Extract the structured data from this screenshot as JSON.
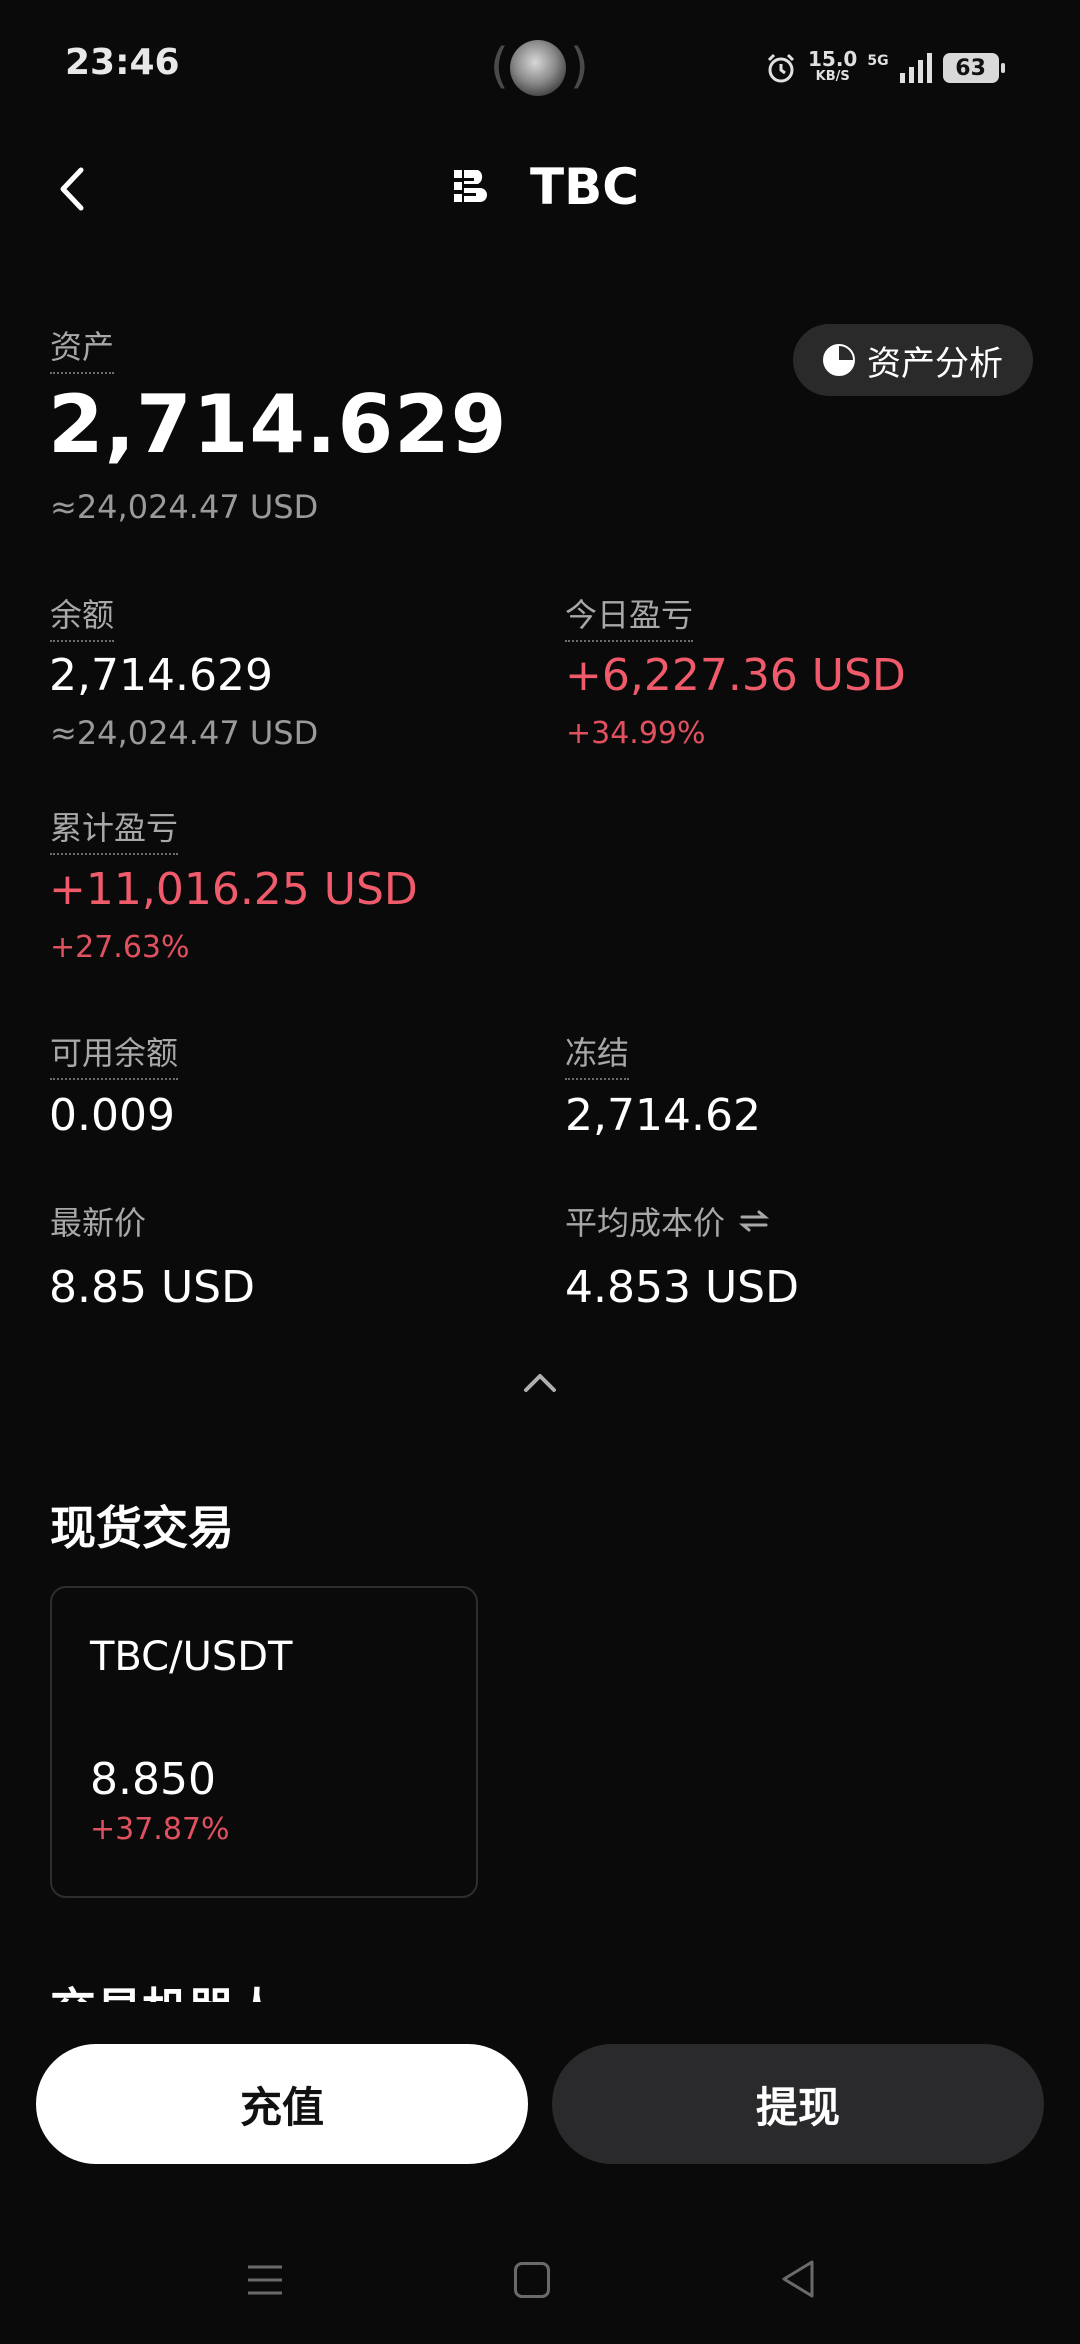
{
  "status_bar": {
    "time": "23:46",
    "speed_value": "15.0",
    "speed_unit": "KB/S",
    "network": "5G",
    "battery": "63"
  },
  "header": {
    "title": "TBC",
    "back_icon": "chevron-left-icon",
    "logo_icon": "brand-logo-icon"
  },
  "assets": {
    "label": "资产",
    "value": "2,714.629",
    "usd": "≈24,024.47 USD",
    "analysis_button": "资产分析"
  },
  "stats": {
    "balance": {
      "label": "余额",
      "value": "2,714.629",
      "usd": "≈24,024.47 USD"
    },
    "today_pnl": {
      "label": "今日盈亏",
      "value": "+6,227.36 USD",
      "percent": "+34.99%"
    },
    "total_pnl": {
      "label": "累计盈亏",
      "value": "+11,016.25 USD",
      "percent": "+27.63%"
    },
    "available": {
      "label": "可用余额",
      "value": "0.009"
    },
    "frozen": {
      "label": "冻结",
      "value": "2,714.62"
    },
    "latest_price": {
      "label": "最新价",
      "value": "8.85 USD"
    },
    "avg_cost": {
      "label": "平均成本价",
      "value": "4.853 USD"
    }
  },
  "spot": {
    "title": "现货交易",
    "pair": "TBC/USDT",
    "price": "8.850",
    "change": "+37.87%"
  },
  "next_section_title": "交易机器人",
  "actions": {
    "deposit": "充值",
    "withdraw": "提现"
  },
  "colors": {
    "positive": "#ef5b6a",
    "background": "#0a0a0a",
    "card_border": "#2e2e2e"
  }
}
